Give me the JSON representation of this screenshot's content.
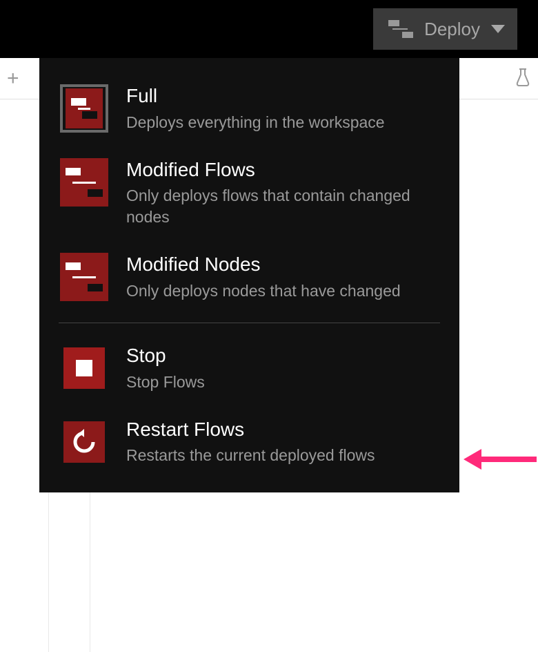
{
  "header": {
    "deploy_label": "Deploy"
  },
  "menu": {
    "full": {
      "title": "Full",
      "desc": "Deploys everything in the workspace"
    },
    "modified_flows": {
      "title": "Modified Flows",
      "desc": "Only deploys flows that contain changed nodes"
    },
    "modified_nodes": {
      "title": "Modified Nodes",
      "desc": "Only deploys nodes that have changed"
    },
    "stop": {
      "title": "Stop",
      "desc": "Stop Flows"
    },
    "restart": {
      "title": "Restart Flows",
      "desc": "Restarts the current deployed flows"
    }
  },
  "colors": {
    "brand_red": "#8c1a1a",
    "accent_pink": "#ff2a7a"
  }
}
